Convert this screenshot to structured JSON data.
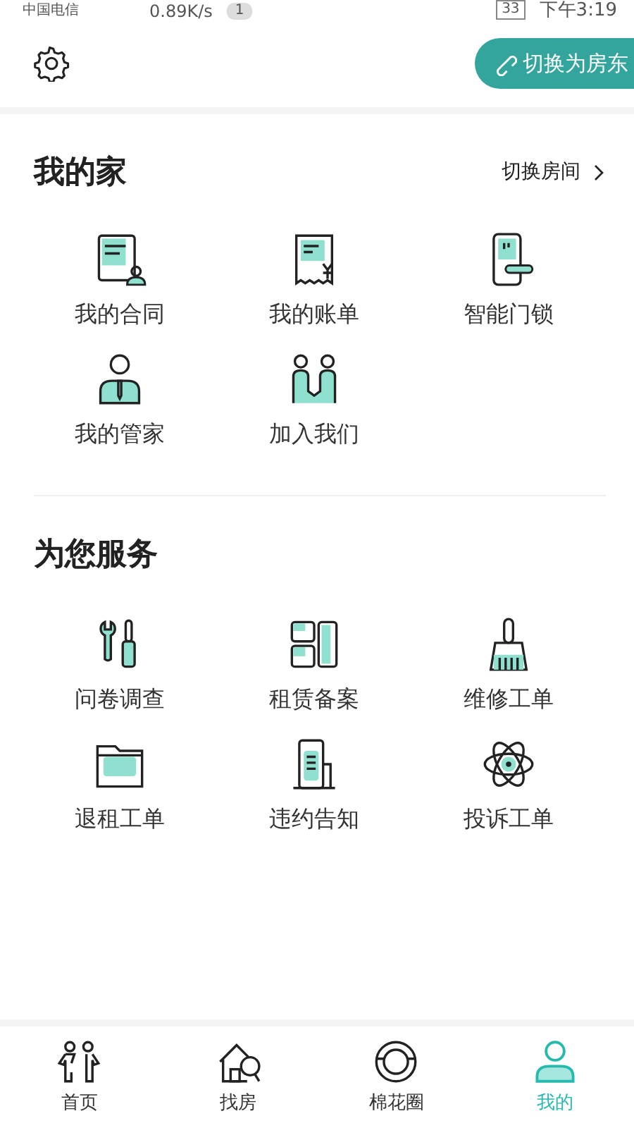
{
  "status_bar": {
    "carrier": "中国电信",
    "speed": "0.89K/s",
    "notification_count": "1",
    "battery": "33",
    "time": "下午3:19"
  },
  "header": {
    "switch_button": "切换为房东"
  },
  "sections": [
    {
      "title": "我的家",
      "action": "切换房间",
      "items": [
        {
          "label": "我的合同"
        },
        {
          "label": "我的账单"
        },
        {
          "label": "智能门锁"
        },
        {
          "label": "我的管家"
        },
        {
          "label": "加入我们"
        }
      ]
    },
    {
      "title": "为您服务",
      "items": [
        {
          "label": "问卷调查"
        },
        {
          "label": "租赁备案"
        },
        {
          "label": "维修工单"
        },
        {
          "label": "退租工单"
        },
        {
          "label": "违约告知"
        },
        {
          "label": "投诉工单"
        }
      ]
    }
  ],
  "tabs": [
    {
      "label": "首页",
      "selected": false
    },
    {
      "label": "找房",
      "selected": false
    },
    {
      "label": "棉花圈",
      "selected": false
    },
    {
      "label": "我的",
      "selected": true
    }
  ]
}
